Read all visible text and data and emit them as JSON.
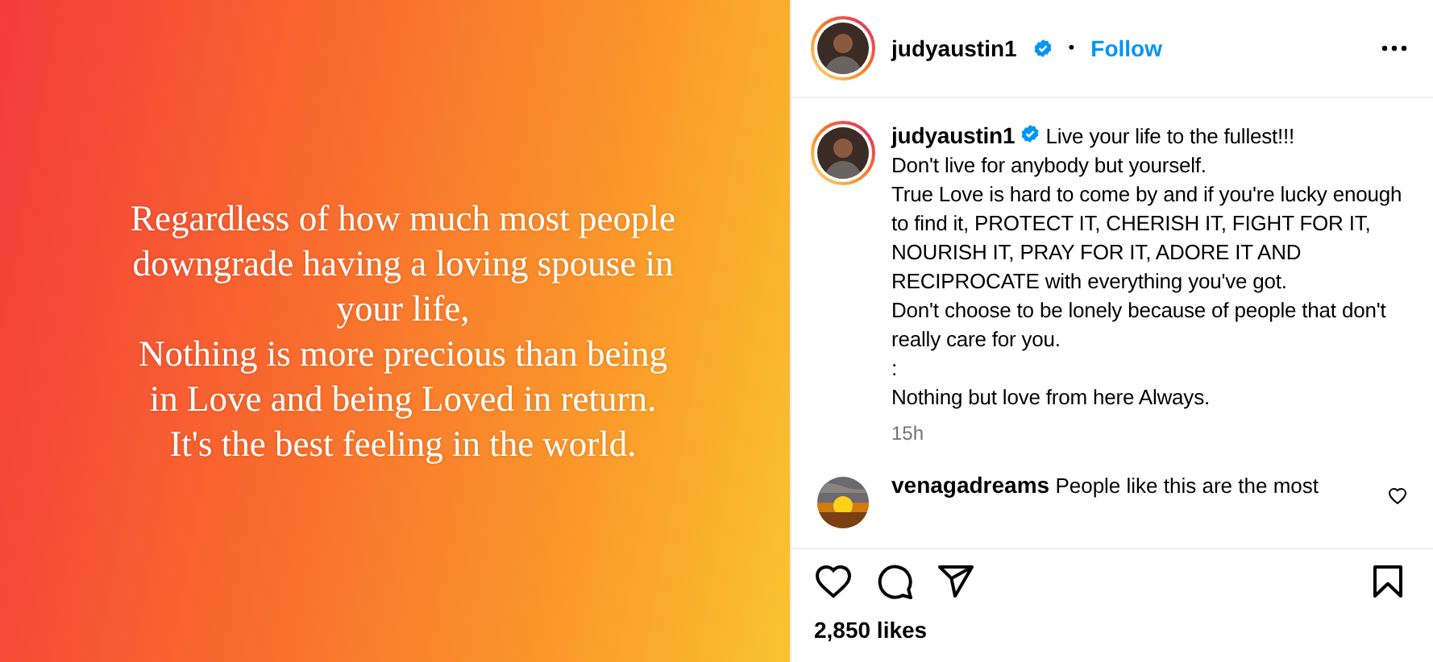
{
  "post_image": {
    "quote_lines": [
      "Regardless of how much most people",
      "downgrade having a loving spouse in",
      "your life,",
      "Nothing is more precious than being",
      "in Love and being Loved in return.",
      "It's the best feeling in the world."
    ]
  },
  "header": {
    "username": "judyaustin1",
    "verified": true,
    "separator": "•",
    "follow": "Follow"
  },
  "caption": {
    "username": "judyaustin1",
    "verified": true,
    "text": "Live your life to the fullest!!!\nDon't live for anybody but yourself.\nTrue Love is hard to come by and if you're lucky enough to find it, PROTECT IT, CHERISH IT, FIGHT FOR IT, NOURISH IT, PRAY FOR IT, ADORE IT AND RECIPROCATE with everything you've got.\nDon't choose to be lonely because of people that don't really care for you.\n:\nNothing but love from here Always.",
    "time": "15h"
  },
  "comments": [
    {
      "username": "venagadreams",
      "text": "People like this are the most",
      "liked": false
    }
  ],
  "actions": {
    "liked": false,
    "saved": false
  },
  "likes": "2,850 likes"
}
